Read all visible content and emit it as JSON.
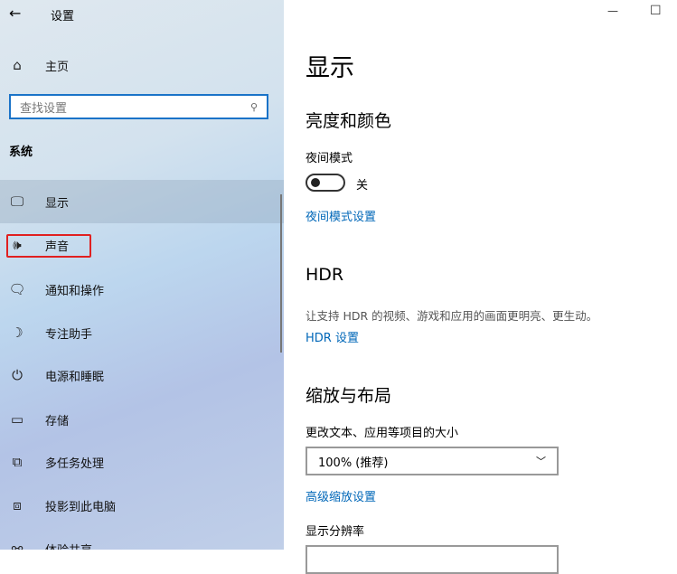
{
  "window": {
    "title": "设置",
    "back_icon": "arrow-left",
    "minimize": "—",
    "maximize": "☐"
  },
  "sidebar": {
    "home": "主页",
    "search_placeholder": "查找设置",
    "section": "系统",
    "items": [
      {
        "label": "显示",
        "icon": "monitor"
      },
      {
        "label": "声音",
        "icon": "speaker"
      },
      {
        "label": "通知和操作",
        "icon": "message"
      },
      {
        "label": "专注助手",
        "icon": "moon"
      },
      {
        "label": "电源和睡眠",
        "icon": "power"
      },
      {
        "label": "存储",
        "icon": "storage"
      },
      {
        "label": "多任务处理",
        "icon": "multitask"
      },
      {
        "label": "投影到此电脑",
        "icon": "project"
      },
      {
        "label": "体验共享",
        "icon": "share"
      }
    ]
  },
  "main": {
    "title": "显示",
    "brightness": {
      "heading": "亮度和颜色",
      "night_label": "夜间模式",
      "toggle_state": "关",
      "night_link": "夜间模式设置"
    },
    "hdr": {
      "heading": "HDR",
      "desc": "让支持 HDR 的视频、游戏和应用的画面更明亮、更生动。",
      "link": "HDR 设置"
    },
    "scale": {
      "heading": "缩放与布局",
      "size_label": "更改文本、应用等项目的大小",
      "size_value": "100% (推荐)",
      "advanced_link": "高级缩放设置",
      "resolution_label": "显示分辨率"
    }
  },
  "colors": {
    "accent": "#0067b8",
    "highlight": "#e02020"
  }
}
